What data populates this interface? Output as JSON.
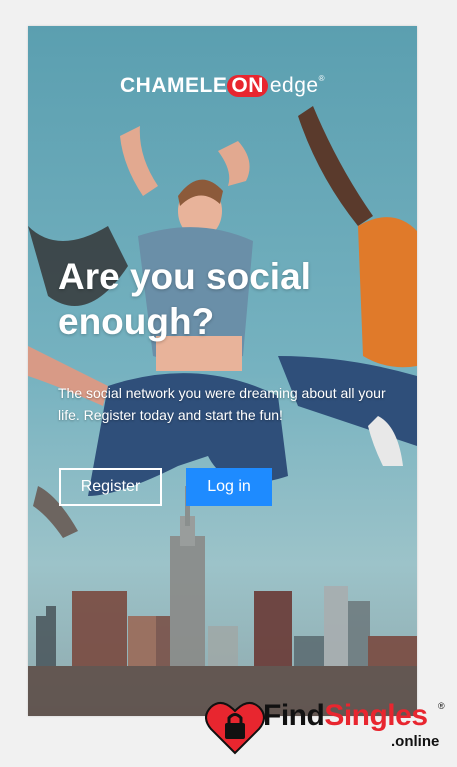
{
  "brand": {
    "logo_part1": "CHAMELE",
    "logo_on": "ON",
    "logo_part2": "edge",
    "logo_mark": "®"
  },
  "hero": {
    "headline": "Are you social enough?",
    "subtext": "The social network you were dreaming about all your life. Register today and start the fun!"
  },
  "actions": {
    "register_label": "Register",
    "login_label": "Log in"
  },
  "watermark": {
    "find": "Find",
    "singles": "Singles",
    "online": ".online",
    "mark": "®"
  },
  "colors": {
    "primary_button": "#1e8bff",
    "brand_red": "#e8262f",
    "text": "#ffffff"
  }
}
